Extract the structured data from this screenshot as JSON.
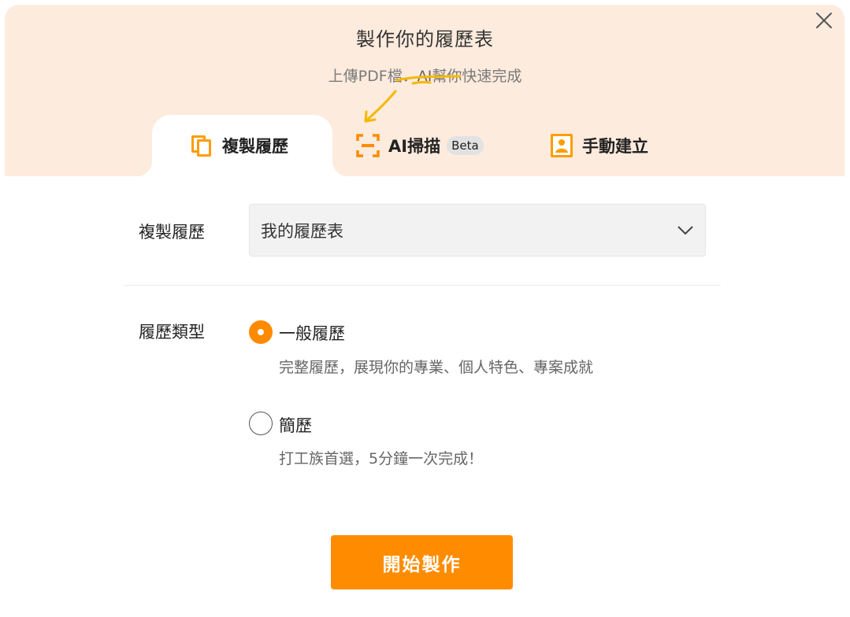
{
  "dialog": {
    "title": "製作你的履歷表",
    "subtitle_prefix": "上傳PDF檔．",
    "subtitle_ai": "AI",
    "subtitle_suffix": "幫你快速完成"
  },
  "tabs": [
    {
      "label": "複製履歷",
      "icon": "copy-icon",
      "active": true
    },
    {
      "label": "AI掃描",
      "icon": "scan-icon",
      "badge": "Beta",
      "active": false
    },
    {
      "label": "手動建立",
      "icon": "profile-card-icon",
      "active": false
    }
  ],
  "form": {
    "copy_label": "複製履歷",
    "copy_selected": "我的履歷表",
    "type_label": "履歷類型",
    "options": [
      {
        "title": "一般履歷",
        "desc": "完整履歷，展現你的專業、個人特色、專案成就",
        "selected": true
      },
      {
        "title": "簡歷",
        "desc": "打工族首選，5分鐘一次完成！",
        "selected": false
      }
    ]
  },
  "start_button": "開始製作",
  "colors": {
    "accent": "#ff8c00",
    "header_bg": "#fdebdd",
    "scribble": "#f5b800"
  }
}
